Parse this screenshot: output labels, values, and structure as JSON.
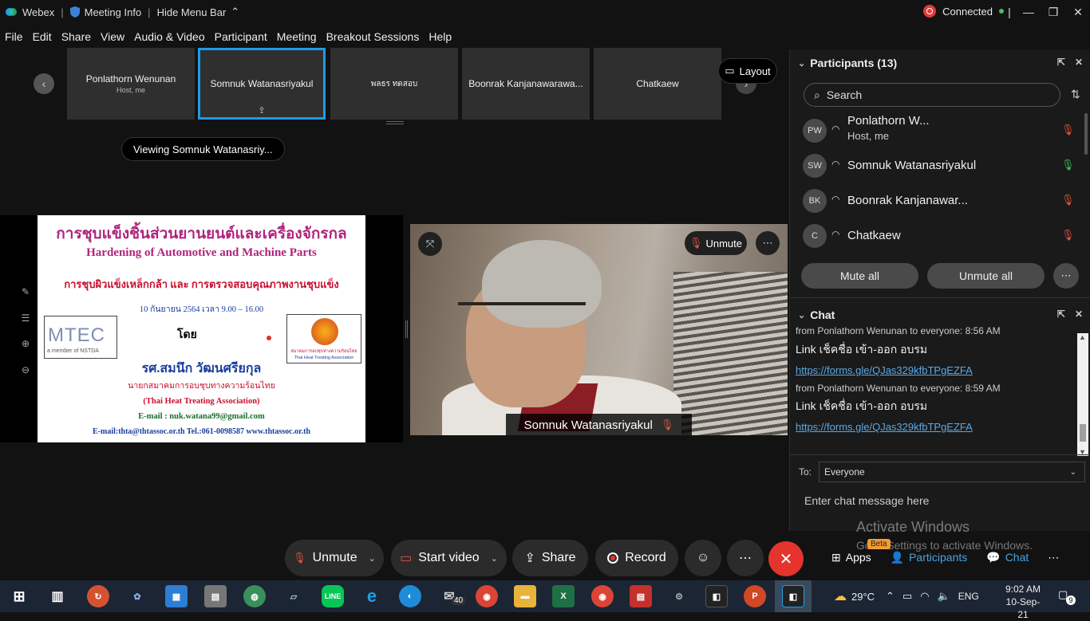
{
  "titlebar": {
    "app_name": "Webex",
    "meeting_info": "Meeting Info",
    "hide_menu_bar": "Hide Menu Bar",
    "status": "Connected"
  },
  "menu": [
    "File",
    "Edit",
    "Share",
    "View",
    "Audio & Video",
    "Participant",
    "Meeting",
    "Breakout Sessions",
    "Help"
  ],
  "thumbnails": [
    {
      "name": "Ponlathorn Wenunan",
      "sub": "Host, me",
      "active": false
    },
    {
      "name": "Somnuk Watanasriyakul",
      "sub": "",
      "active": true
    },
    {
      "name": "พลธร ทดสอบ",
      "sub": "",
      "active": false
    },
    {
      "name": "Boonrak Kanjanawarawa...",
      "sub": "",
      "active": false
    },
    {
      "name": "Chatkaew",
      "sub": "",
      "active": false
    }
  ],
  "layout_label": "Layout",
  "viewing_label": "Viewing Somnuk Watanasriy...",
  "slide": {
    "title_th": "การชุบแข็งชิ้นส่วนยานยนต์และเครื่องจักรกล",
    "title_en": "Hardening of Automotive and Machine Parts",
    "subtitle_th": "การชุบผิวแข็งเหล็กกล้า และ การตรวจสอบคุณภาพงานชุบแข็ง",
    "date": "10 กันยายน 2564    เวลา 9.00 – 16.00",
    "by": "โดย",
    "presenter": "รศ.สมนึก  วัฒนศรียกุล",
    "position": "นายกสมาคมการอบชุบทางความร้อนไทย",
    "assoc": "(Thai Heat Treating Association)",
    "email1": "E-mail : nuk.watana99@gmail.com",
    "footer": "E-mail:thta@thtassoc.or.th     Tel.:061-0098587     www.thtassoc.or.th",
    "mtec": "MTEC",
    "mtec_sub": "a member of NSTDA",
    "thta_line1": "สมาคมการอบชุบทางความร้อนไทย",
    "thta_line2": "Thai Heat Treating Association"
  },
  "video": {
    "unmute_label": "Unmute",
    "name": "Somnuk Watanasriyakul"
  },
  "controls": {
    "unmute": "Unmute",
    "start_video": "Start video",
    "share": "Share",
    "record": "Record"
  },
  "participants": {
    "header": "Participants (13)",
    "search_placeholder": "Search",
    "list": [
      {
        "initials": "PW",
        "name": "Ponlathorn W...",
        "sub": "Host, me",
        "mic": "muted"
      },
      {
        "initials": "SW",
        "name": "Somnuk Watanasriyakul",
        "sub": "",
        "mic": "active"
      },
      {
        "initials": "BK",
        "name": "Boonrak Kanjanawar...",
        "sub": "",
        "mic": "muted"
      },
      {
        "initials": "C",
        "name": "Chatkaew",
        "sub": "",
        "mic": "muted"
      }
    ],
    "mute_all": "Mute all",
    "unmute_all": "Unmute all"
  },
  "chat": {
    "header": "Chat",
    "messages": [
      {
        "meta": "from Ponlathorn Wenunan to everyone:   8:56 AM",
        "text": "Link เช็คชื่อ เข้า-ออก อบรม",
        "link": "https://forms.gle/QJas329kfbTPgEZFA"
      },
      {
        "meta": "from Ponlathorn Wenunan to everyone:   8:59 AM",
        "text": "Link เช็คชื่อ เข้า-ออก อบรม",
        "link": "https://forms.gle/QJas329kfbTPgEZFA"
      }
    ],
    "to_label": "To:",
    "to_value": "Everyone",
    "input_placeholder": "Enter chat message here"
  },
  "bottom_right": {
    "apps": "Apps",
    "beta": "Beta",
    "participants": "Participants",
    "chat": "Chat"
  },
  "watermark": {
    "line1": "Activate Windows",
    "line2": "Go to Settings to activate Windows."
  },
  "taskbar": {
    "weather": "29°C",
    "lang": "ENG",
    "time": "9:02 AM",
    "date": "10-Sep-21",
    "mail_badge": "40",
    "notif_count": "9"
  },
  "colors": {
    "accent_blue": "#1e9be8",
    "end_red": "#e4342d",
    "link": "#5aa9e6",
    "beta": "#f39c34"
  }
}
